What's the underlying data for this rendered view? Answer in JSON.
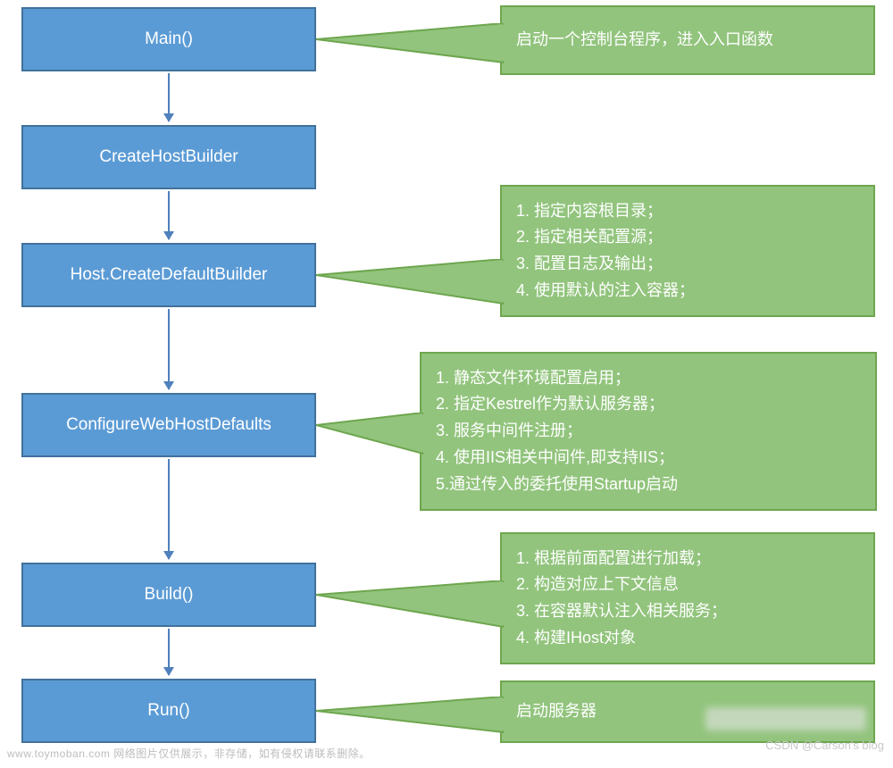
{
  "flow": {
    "box1": "Main()",
    "box2": "CreateHostBuilder",
    "box3": "Host.CreateDefaultBuilder",
    "box4": "ConfigureWebHostDefaults",
    "box5": "Build()",
    "box6": "Run()"
  },
  "callouts": {
    "c1": {
      "l1": "启动一个控制台程序，进入入口函数"
    },
    "c3": {
      "l1": "1. 指定内容根目录；",
      "l2": "2. 指定相关配置源；",
      "l3": "3. 配置日志及输出；",
      "l4": "4. 使用默认的注入容器；"
    },
    "c4": {
      "l1": "1. 静态文件环境配置启用；",
      "l2": "2. 指定Kestrel作为默认服务器；",
      "l3": "3. 服务中间件注册；",
      "l4": "4. 使用IIS相关中间件,即支持IIS；",
      "l5": "5.通过传入的委托使用Startup启动"
    },
    "c5": {
      "l1": "1. 根据前面配置进行加载；",
      "l2": "2. 构造对应上下文信息",
      "l3": "3. 在容器默认注入相关服务；",
      "l4": "4. 构建IHost对象"
    },
    "c6": {
      "l1": "启动服务器"
    }
  },
  "footer": {
    "left": "www.toymoban.com 网络图片仅供展示，非存储，如有侵权请联系删除。",
    "right": "CSDN @Carson's  blog"
  },
  "colors": {
    "flow_fill": "#5b9bd5",
    "flow_border": "#41719c",
    "callout_fill": "#92c47d",
    "callout_border": "#6ea64f",
    "arrow": "#4f81bd"
  }
}
